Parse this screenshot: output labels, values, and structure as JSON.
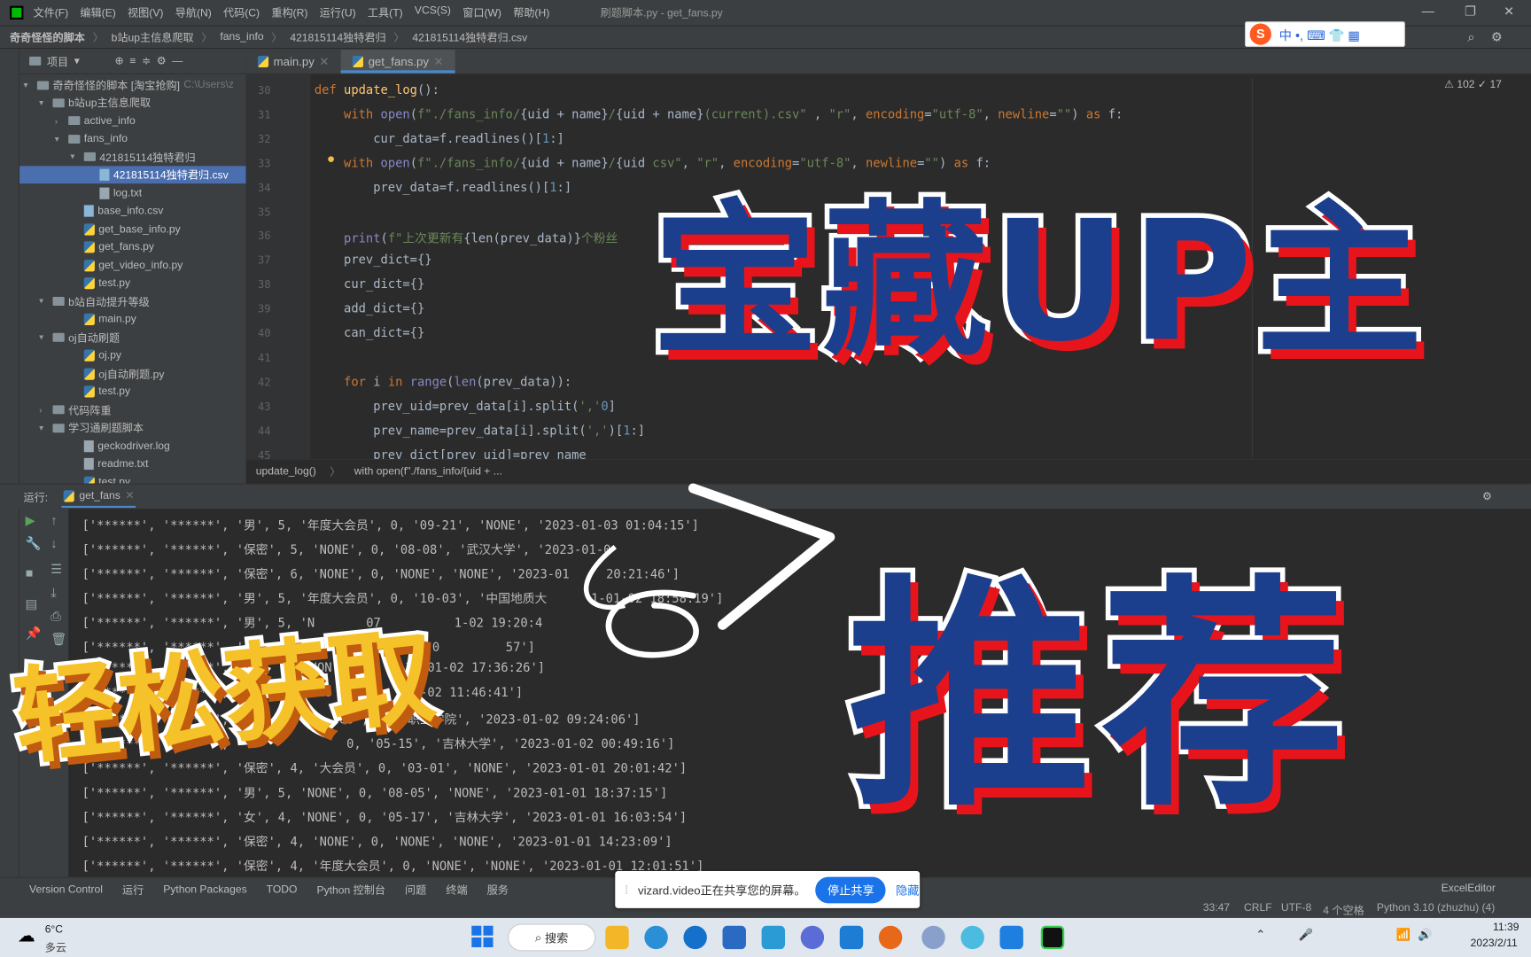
{
  "menubar": {
    "items": [
      "文件(F)",
      "编辑(E)",
      "视图(V)",
      "导航(N)",
      "代码(C)",
      "重构(R)",
      "运行(U)",
      "工具(T)",
      "VCS(S)",
      "窗口(W)",
      "帮助(H)"
    ],
    "window_title": "刷题脚本.py - get_fans.py"
  },
  "navbar": {
    "crumbs": [
      "奇奇怪怪的脚本",
      "b站up主信息爬取",
      "fans_info",
      "421815114独特君归",
      "421815114独特君归.csv"
    ]
  },
  "ime": {
    "glyphs": "中 •, ⌨ 👕 ▦"
  },
  "project": {
    "title": "项目",
    "root_label": "奇奇怪怪的脚本 [淘宝抢购]",
    "root_path": "C:\\Users\\z",
    "items": [
      {
        "label": "b站up主信息爬取",
        "type": "folder"
      },
      {
        "label": "active_info",
        "type": "folder"
      },
      {
        "label": "fans_info",
        "type": "folder"
      },
      {
        "label": "421815114独特君归",
        "type": "folder"
      },
      {
        "label": "421815114独特君归.csv",
        "type": "csv"
      },
      {
        "label": "log.txt",
        "type": "txt"
      },
      {
        "label": "base_info.csv",
        "type": "csv"
      },
      {
        "label": "get_base_info.py",
        "type": "py"
      },
      {
        "label": "get_fans.py",
        "type": "py"
      },
      {
        "label": "get_video_info.py",
        "type": "py"
      },
      {
        "label": "test.py",
        "type": "py"
      },
      {
        "label": "b站自动提升等级",
        "type": "folder"
      },
      {
        "label": "main.py",
        "type": "py"
      },
      {
        "label": "oj自动刷题",
        "type": "folder"
      },
      {
        "label": "oj.py",
        "type": "py"
      },
      {
        "label": "oj自动刷题.py",
        "type": "py"
      },
      {
        "label": "test.py",
        "type": "py"
      },
      {
        "label": "代码阵重",
        "type": "folder"
      },
      {
        "label": "学习通刷题脚本",
        "type": "folder"
      },
      {
        "label": "geckodriver.log",
        "type": "txt"
      },
      {
        "label": "readme.txt",
        "type": "txt"
      },
      {
        "label": "test.py",
        "type": "py"
      }
    ]
  },
  "tabs": [
    "main.py",
    "get_fans.py"
  ],
  "editor": {
    "warnings": "⚠ 102 ✓ 17",
    "lines": [
      {
        "n": "30",
        "segs": [
          [
            "kw",
            "def "
          ],
          [
            "fn",
            "update_log"
          ],
          [
            "",
            "():"
          ]
        ]
      },
      {
        "n": "31",
        "segs": [
          [
            "",
            "    "
          ],
          [
            "kw",
            "with "
          ],
          [
            "bi",
            "open"
          ],
          [
            "",
            "("
          ],
          [
            "str",
            "f\"./fans_info/"
          ],
          [
            "",
            "{uid + name}"
          ],
          [
            "str",
            "/"
          ],
          [
            "",
            "{uid + name}"
          ],
          [
            "str",
            "(current).csv\""
          ],
          [
            "",
            " , "
          ],
          [
            "str",
            "\"r\""
          ],
          [
            "",
            ", "
          ],
          [
            "kw",
            "encoding"
          ],
          [
            "",
            "="
          ],
          [
            "str",
            "\"utf-8\""
          ],
          [
            "",
            ", "
          ],
          [
            "kw",
            "newline"
          ],
          [
            "",
            "="
          ],
          [
            "str",
            "\"\""
          ],
          [
            "",
            ") "
          ],
          [
            "kw",
            "as "
          ],
          [
            "",
            "f:"
          ]
        ]
      },
      {
        "n": "32",
        "segs": [
          [
            "",
            "        cur_data=f.readlines()["
          ],
          [
            "num",
            "1"
          ],
          [
            "",
            ":]"
          ]
        ]
      },
      {
        "n": "33",
        "segs": [
          [
            "",
            "    "
          ],
          [
            "kw",
            "with "
          ],
          [
            "bi",
            "open"
          ],
          [
            "",
            "("
          ],
          [
            "str",
            "f\"./fans_info/"
          ],
          [
            "",
            "{uid + name}"
          ],
          [
            "str",
            "/"
          ],
          [
            "",
            "{uid "
          ],
          [
            "",
            ""
          ],
          [
            "str",
            "csv\""
          ],
          [
            "",
            ", "
          ],
          [
            "str",
            "\"r\""
          ],
          [
            "",
            ", "
          ],
          [
            "kw",
            "encoding"
          ],
          [
            "",
            "="
          ],
          [
            "str",
            "\"utf-8\""
          ],
          [
            "",
            ", "
          ],
          [
            "kw",
            "newline"
          ],
          [
            "",
            "="
          ],
          [
            "str",
            "\"\""
          ],
          [
            "",
            ") "
          ],
          [
            "kw",
            "as "
          ],
          [
            "",
            "f:"
          ]
        ]
      },
      {
        "n": "34",
        "segs": [
          [
            "",
            "        prev_data=f.readlines()["
          ],
          [
            "num",
            "1"
          ],
          [
            "",
            ":]"
          ]
        ]
      },
      {
        "n": "35",
        "segs": []
      },
      {
        "n": "36",
        "segs": [
          [
            "",
            "    "
          ],
          [
            "bi",
            "print"
          ],
          [
            "",
            "("
          ],
          [
            "str",
            "f\"上次更新有"
          ],
          [
            "",
            "{len(prev_data)}"
          ],
          [
            "str",
            "个粉丝"
          ]
        ]
      },
      {
        "n": "37",
        "segs": [
          [
            "",
            "    prev_dict={}"
          ]
        ]
      },
      {
        "n": "38",
        "segs": [
          [
            "",
            "    cur_dict={}"
          ]
        ]
      },
      {
        "n": "39",
        "segs": [
          [
            "",
            "    add_dict={}"
          ]
        ]
      },
      {
        "n": "40",
        "segs": [
          [
            "",
            "    can_dict={}"
          ]
        ]
      },
      {
        "n": "41",
        "segs": []
      },
      {
        "n": "42",
        "segs": [
          [
            "",
            "    "
          ],
          [
            "kw",
            "for "
          ],
          [
            "",
            "i "
          ],
          [
            "kw",
            "in "
          ],
          [
            "bi",
            "range"
          ],
          [
            "",
            "("
          ],
          [
            "bi",
            "len"
          ],
          [
            "",
            "(prev_data)):"
          ]
        ]
      },
      {
        "n": "43",
        "segs": [
          [
            "",
            "        prev_uid=prev_data[i].split("
          ],
          [
            "str",
            "','"
          ],
          [
            ")[",
            ""
          ],
          [
            "num",
            "0"
          ],
          [
            "",
            "]"
          ]
        ]
      },
      {
        "n": "44",
        "segs": [
          [
            "",
            "        prev_name=prev_data[i].split("
          ],
          [
            "str",
            "','"
          ],
          [
            "",
            ")["
          ],
          [
            "num",
            "1"
          ],
          [
            "",
            ":]"
          ]
        ]
      },
      {
        "n": "45",
        "segs": [
          [
            "",
            "        prev_dict[prev_uid]=prev_name"
          ]
        ]
      }
    ]
  },
  "breadcrumb": {
    "func": "update_log()",
    "stmt": "with open(f\"./fans_info/{uid + ..."
  },
  "run": {
    "label": "运行:",
    "tab": "get_fans"
  },
  "console": {
    "lines": [
      "['******', '******', '男', 5, '年度大会员', 0, '09-21', 'NONE', '2023-01-03 01:04:15']",
      "['******', '******', '保密', 5, 'NONE', 0, '08-08', '武汉大学', '2023-01-0",
      "['******', '******', '保密', 6, 'NONE', 0, 'NONE', 'NONE', '2023-01     20:21:46']",
      "['******', '******', '男', 5, '年度大会员', 0, '10-03', '中国地质大      1-01-02 18:58:19']",
      "['******', '******', '男', 5, 'N       07          1-02 19:20:4",
      "['******', '******', '保        NO           23-0         57']",
      "['******', '******',           NON          23-01-02 17:36:26']",
      "['******', '******',            NO           1-02 11:46:41']",
      "['******', '******',              '05', '城市职业学院', '2023-01-02 09:24:06']",
      "['******', '******',                0, '05-15', '吉林大学', '2023-01-02 00:49:16']",
      "['******', '******', '保密', 4, '大会员', 0, '03-01', 'NONE', '2023-01-01 20:01:42']",
      "['******', '******', '男', 5, 'NONE', 0, '08-05', 'NONE', '2023-01-01 18:37:15']",
      "['******', '******', '女', 4, 'NONE', 0, '05-17', '吉林大学', '2023-01-01 16:03:54']",
      "['******', '******', '保密', 4, 'NONE', 0, 'NONE', 'NONE', '2023-01-01 14:23:09']",
      "['******', '******', '保密', 4, '年度大会员', 0, 'NONE', 'NONE', '2023-01-01 12:01:51']"
    ]
  },
  "bottom_tabs": [
    "Version Control",
    "运行",
    "Python Packages",
    "TODO",
    "Python 控制台",
    "问题",
    "终端",
    "服务"
  ],
  "share": {
    "text": "vizard.video正在共享您的屏幕。",
    "stop": "停止共享",
    "hide": "隐藏"
  },
  "status": {
    "pos": "33:47",
    "eol": "CRLF",
    "enc": "UTF-8",
    "indent": "4 个空格",
    "interp": "Python 3.10 (zhuzhu) (4)",
    "plugin": "ExcelEditor"
  },
  "taskbar": {
    "temp": "6°C",
    "weather": "多云",
    "search": "搜索",
    "time": "11:39",
    "date": "2023/2/11"
  },
  "overlay": {
    "line1": "宝藏UP主",
    "line2": "推荐",
    "line3": "轻松获取"
  },
  "colors": {
    "overlay_blue": "#1b3f8c",
    "overlay_red": "#e8141b",
    "overlay_yellow": "#f5c229",
    "selection": "#4b6eaf"
  }
}
